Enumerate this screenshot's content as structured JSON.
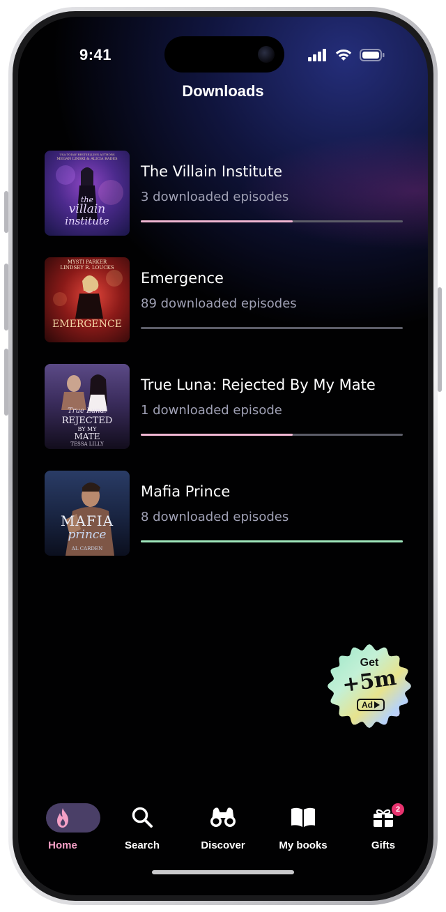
{
  "status_bar": {
    "time": "9:41"
  },
  "header": {
    "title": "Downloads"
  },
  "downloads": [
    {
      "title": "The Villain Institute",
      "subtitle": "3 downloaded episodes",
      "progress": 0.58,
      "progress_color": "#f0b6d2",
      "cover": {
        "top_text": "USA TODAY BESTSELLING AUTHORS",
        "authors": "MEGAN LINSKI & ALICIA RADES",
        "title_line1": "the",
        "title_line2": "villain",
        "title_line3": "institute"
      }
    },
    {
      "title": "Emergence",
      "subtitle": "89 downloaded episodes",
      "progress": 0.0,
      "progress_color": "#f0b6d2",
      "cover": {
        "top_text": "MYSTI PARKER",
        "authors": "LINDSEY R. LOUCKS",
        "title_line1": "EMERGENCE"
      }
    },
    {
      "title": "True Luna: Rejected By My Mate",
      "subtitle": "1 downloaded episode",
      "progress": 0.58,
      "progress_color": "#f0b6d2",
      "cover": {
        "title_line1": "True Luna:",
        "title_line2": "REJECTED",
        "title_line3": "BY MY",
        "title_line4": "MATE",
        "authors": "TESSA LILLY"
      }
    },
    {
      "title": "Mafia Prince",
      "subtitle": "8 downloaded episodes",
      "progress": 1.0,
      "progress_color": "#9fe6bc",
      "cover": {
        "title_line1": "MAFIA",
        "title_line2": "prince",
        "authors": "AL CARDEN"
      }
    }
  ],
  "ad_badge": {
    "line1": "Get",
    "line2": "+5m",
    "line3": "Ad"
  },
  "tabbar": {
    "tabs": [
      {
        "label": "Home",
        "icon": "flame-icon",
        "active": true
      },
      {
        "label": "Search",
        "icon": "search-icon"
      },
      {
        "label": "Discover",
        "icon": "binoculars-icon"
      },
      {
        "label": "My books",
        "icon": "open-book-icon"
      },
      {
        "label": "Gifts",
        "icon": "gift-icon",
        "badge": "2"
      }
    ]
  },
  "colors": {
    "background": "#010102",
    "accent_pink": "#f0b6d2",
    "accent_green": "#9fe6bc",
    "home_pill": "#4a3f67",
    "badge_red": "#e8336f"
  }
}
